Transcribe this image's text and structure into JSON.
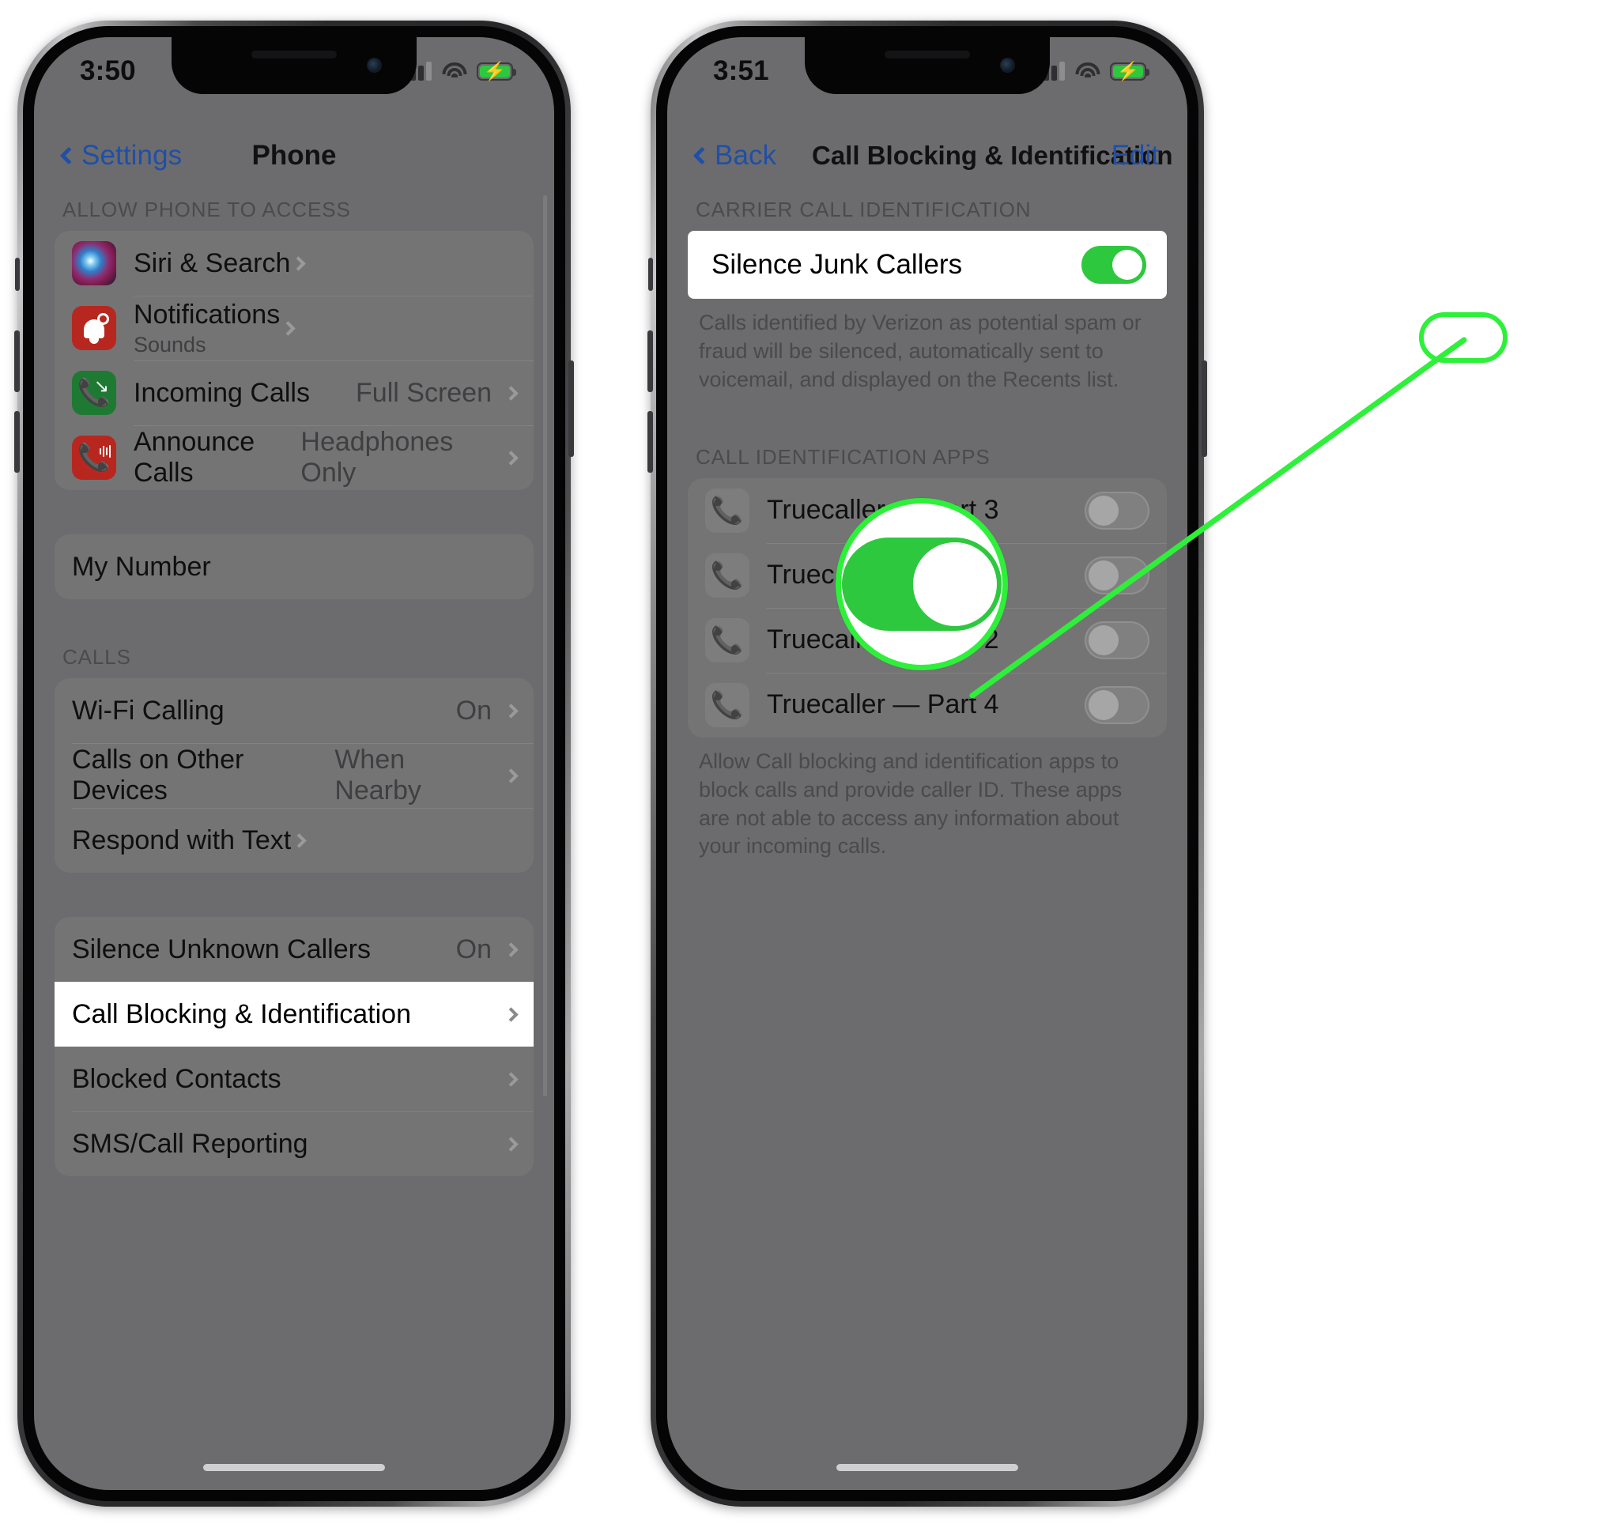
{
  "phone_left": {
    "status": {
      "time": "3:50",
      "cellular_icon": "cellular-bars-icon",
      "wifi_icon": "wifi-icon",
      "battery_icon": "battery-charging-icon"
    },
    "nav": {
      "back_label": "Settings",
      "title": "Phone"
    },
    "sections": [
      {
        "header": "ALLOW PHONE TO ACCESS",
        "rows": [
          {
            "icon": "siri-icon",
            "label": "Siri & Search",
            "sub": "",
            "value": "",
            "chevron": true
          },
          {
            "icon": "bell-icon",
            "label": "Notifications",
            "sub": "Sounds",
            "value": "",
            "chevron": true
          },
          {
            "icon": "phone-down-icon",
            "label": "Incoming Calls",
            "sub": "",
            "value": "Full Screen",
            "chevron": true
          },
          {
            "icon": "phone-wave-icon",
            "label": "Announce Calls",
            "sub": "",
            "value": "Headphones Only",
            "chevron": true
          }
        ]
      },
      {
        "header": "",
        "rows": [
          {
            "icon": "",
            "label": "My Number",
            "sub": "",
            "value": "",
            "chevron": false
          }
        ]
      },
      {
        "header": "CALLS",
        "rows": [
          {
            "icon": "",
            "label": "Wi-Fi Calling",
            "sub": "",
            "value": "On",
            "chevron": true
          },
          {
            "icon": "",
            "label": "Calls on Other Devices",
            "sub": "",
            "value": "When Nearby",
            "chevron": true
          },
          {
            "icon": "",
            "label": "Respond with Text",
            "sub": "",
            "value": "",
            "chevron": true
          }
        ]
      },
      {
        "header": "",
        "rows": [
          {
            "icon": "",
            "label": "Silence Unknown Callers",
            "sub": "",
            "value": "On",
            "chevron": true,
            "highlight": false
          },
          {
            "icon": "",
            "label": "Call Blocking & Identification",
            "sub": "",
            "value": "",
            "chevron": true,
            "highlight": true
          },
          {
            "icon": "",
            "label": "Blocked Contacts",
            "sub": "",
            "value": "",
            "chevron": true,
            "highlight": false
          },
          {
            "icon": "",
            "label": "SMS/Call Reporting",
            "sub": "",
            "value": "",
            "chevron": true,
            "highlight": false
          }
        ]
      }
    ]
  },
  "phone_right": {
    "status": {
      "time": "3:51",
      "cellular_icon": "cellular-bars-icon",
      "wifi_icon": "wifi-icon",
      "battery_icon": "battery-charging-icon"
    },
    "nav": {
      "back_label": "Back",
      "title": "Call Blocking & Identification",
      "right_action": "Edit"
    },
    "carrier_section": {
      "header": "CARRIER CALL IDENTIFICATION",
      "row_label": "Silence Junk Callers",
      "row_toggle_on": true,
      "footnote": "Calls identified by Verizon as potential spam or fraud will be silenced, automatically sent to voicemail, and displayed on the Recents list."
    },
    "apps_section": {
      "header": "CALL IDENTIFICATION APPS",
      "rows": [
        {
          "icon": "phone-handset-icon",
          "label": "Truecaller — Part 3",
          "toggle_on": false
        },
        {
          "icon": "phone-handset-icon",
          "label": "Truecaller — Part 1",
          "toggle_on": false
        },
        {
          "icon": "phone-handset-icon",
          "label": "Truecaller — Part 2",
          "toggle_on": false
        },
        {
          "icon": "phone-handset-icon",
          "label": "Truecaller — Part 4",
          "toggle_on": false
        }
      ],
      "footnote": "Allow Call blocking and identification apps to block calls and provide caller ID. These apps are not able to access any information about your incoming calls."
    }
  },
  "annotation": {
    "accent_color": "#2ef03a",
    "magnified_control": "silence-junk-callers-toggle",
    "magnified_state_on": true
  }
}
